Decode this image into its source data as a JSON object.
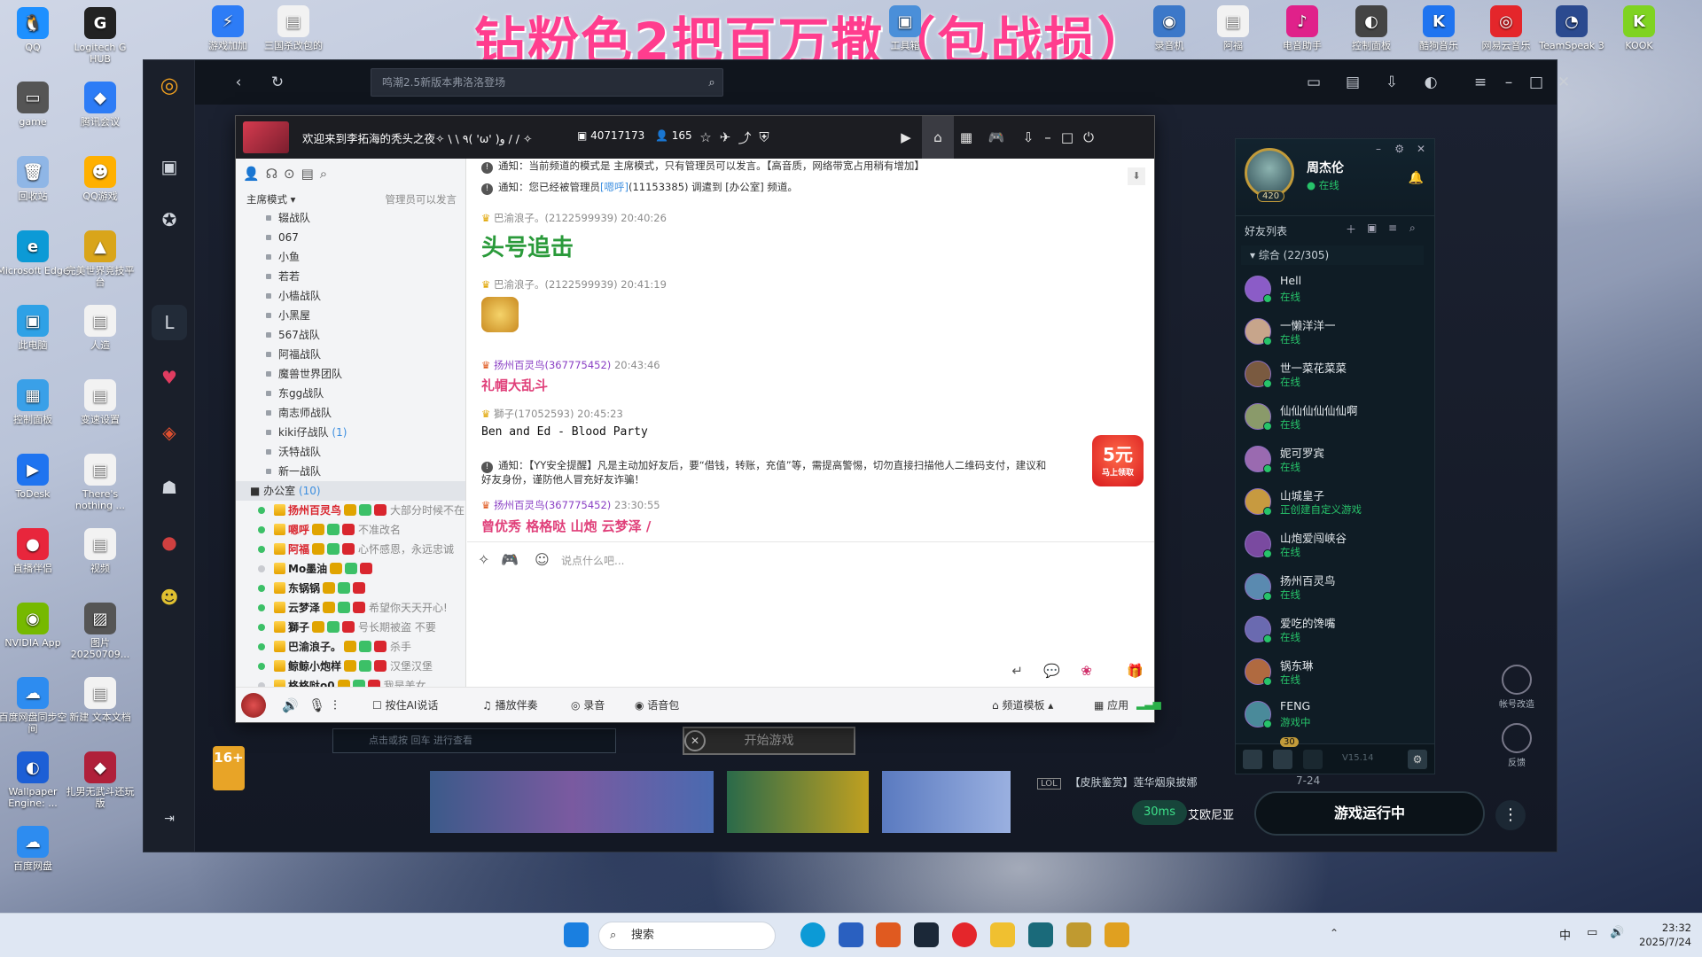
{
  "stream_title": "钻粉色2把百万撒（包战损）",
  "desktop_icons_left": [
    {
      "label": "QQ",
      "color": "#1e90ff",
      "glyph": "🐧"
    },
    {
      "label": "Logitech G HUB",
      "color": "#222222",
      "glyph": "G"
    },
    {
      "label": "game",
      "color": "#555555",
      "glyph": "▭"
    },
    {
      "label": "腾讯会议",
      "color": "#2d7cf6",
      "glyph": "◆"
    },
    {
      "label": "回收站",
      "color": "#8fb6e6",
      "glyph": "🗑"
    },
    {
      "label": "QQ游戏",
      "color": "#ffb000",
      "glyph": "☻"
    },
    {
      "label": "Microsoft Edge",
      "color": "#0c9ad6",
      "glyph": "e"
    },
    {
      "label": "完美世界竞技平台",
      "color": "#d9a51a",
      "glyph": "▲"
    },
    {
      "label": "此电脑",
      "color": "#2ea1e6",
      "glyph": "▣"
    },
    {
      "label": "人造",
      "color": "#f2f2f2",
      "glyph": "▤"
    },
    {
      "label": "控制面板",
      "color": "#3aa0e8",
      "glyph": "▦"
    },
    {
      "label": "变速设置",
      "color": "#f2f2f2",
      "glyph": "▤"
    },
    {
      "label": "ToDesk",
      "color": "#1f74f0",
      "glyph": "▶"
    },
    {
      "label": "There's nothing ...",
      "color": "#f2f2f2",
      "glyph": "▤"
    },
    {
      "label": "直播伴侣",
      "color": "#e8263c",
      "glyph": "●"
    },
    {
      "label": "视频",
      "color": "#f2f2f2",
      "glyph": "▤"
    },
    {
      "label": "NVIDIA App",
      "color": "#76b900",
      "glyph": "◉"
    },
    {
      "label": "图片 20250709...",
      "color": "#555555",
      "glyph": "▨"
    },
    {
      "label": "百度网盘同步空间",
      "color": "#2d8cf0",
      "glyph": "☁"
    },
    {
      "label": "新建 文本文档",
      "color": "#f2f2f2",
      "glyph": "▤"
    },
    {
      "label": "Wallpaper Engine: ...",
      "color": "#1c5fd6",
      "glyph": "◐"
    },
    {
      "label": "扎男无武斗还玩版",
      "color": "#b0203a",
      "glyph": "◆"
    },
    {
      "label": "百度网盘",
      "color": "#2d8cf0",
      "glyph": "☁"
    }
  ],
  "desktop_icons_top": [
    {
      "label": "游戏加加",
      "color": "#2d7cf6",
      "glyph": "⚡"
    },
    {
      "label": "三国杀改包的",
      "color": "#f2f2f2",
      "glyph": "▤"
    },
    {
      "label": "工具箱",
      "color": "#4a8fd9",
      "glyph": "▣"
    },
    {
      "label": "录音机",
      "color": "#3c78c9",
      "glyph": "◉"
    },
    {
      "label": "阿福",
      "color": "#f2f2f2",
      "glyph": "▤"
    },
    {
      "label": "电音助手",
      "color": "#e0218a",
      "glyph": "♪"
    },
    {
      "label": "控制面板",
      "color": "#444444",
      "glyph": "◐"
    },
    {
      "label": "酷狗音乐",
      "color": "#1f74f0",
      "glyph": "K"
    },
    {
      "label": "网易云音乐",
      "color": "#e4262b",
      "glyph": "◎"
    },
    {
      "label": "TeamSpeak 3",
      "color": "#2b4a8f",
      "glyph": "◔"
    },
    {
      "label": "KOOK",
      "color": "#7fd321",
      "glyph": "K"
    }
  ],
  "client": {
    "search_placeholder": "鸣潮2.5新版本弗洛洛登场"
  },
  "yy": {
    "channel_title": "欢迎来到李拓海的秃头之夜✧ \\ \\ ٩( 'ω' )و / / ✧",
    "channel_id": "40717173",
    "online_count": "165",
    "mode": "主席模式",
    "mode_note": "管理员可以发言",
    "subchannels": [
      {
        "name": "辍战队"
      },
      {
        "name": "067"
      },
      {
        "name": "小鱼"
      },
      {
        "name": "若若"
      },
      {
        "name": "小樯战队"
      },
      {
        "name": "小黑屋"
      },
      {
        "name": "567战队"
      },
      {
        "name": "阿福战队"
      },
      {
        "name": "魔兽世界团队"
      },
      {
        "name": "东gg战队"
      },
      {
        "name": "南志师战队"
      },
      {
        "name": "kiki仔战队",
        "count": "(1)"
      },
      {
        "name": "沃特战队"
      },
      {
        "name": "新一战队"
      }
    ],
    "office": {
      "name": "办公室",
      "count": "(10)"
    },
    "members": [
      {
        "nick": "扬州百灵鸟",
        "sig": "大部分时候不在",
        "red": true,
        "online": true
      },
      {
        "nick": "嗯呼",
        "sig": "不准改名",
        "red": true,
        "online": true
      },
      {
        "nick": "阿福",
        "sig": "心怀感恩，永远忠诚",
        "red": true,
        "online": true
      },
      {
        "nick": "Mo墨油",
        "sig": "",
        "red": false,
        "online": false
      },
      {
        "nick": "东锅锅",
        "sig": "",
        "red": false,
        "online": true
      },
      {
        "nick": "云梦泽",
        "sig": "希望你天天开心!",
        "red": false,
        "online": true
      },
      {
        "nick": "獅子",
        "sig": "号长期被盗 不要",
        "red": false,
        "online": true
      },
      {
        "nick": "巴渝浪子。",
        "sig": "杀手",
        "red": false,
        "online": true
      },
      {
        "nick": "鲸鲸小炮样",
        "sig": "汉堡汉堡",
        "red": false,
        "online": true
      },
      {
        "nick": "格格哒o0",
        "sig": "我是美女",
        "red": false,
        "online": false
      }
    ],
    "chat": {
      "notice1": "通知：当前频道的模式是 主席模式，只有管理员可以发言。【高音质，网络带宽占用稍有增加】",
      "notice2_pre": "通知：您已经被管理员",
      "notice2_link": "[嗯呼]",
      "notice2_post": "(11153385) 调遣到 [办公室] 频道。",
      "msg1_meta": "巴渝浪子。(2122599939)  20:40:26",
      "msg1_text": "头号追击",
      "msg2_meta": "巴渝浪子。(2122599939)  20:41:19",
      "msg3_meta_name": "扬州百灵鸟(367775452)",
      "msg3_meta_time": "20:43:46",
      "msg3_text": "礼帽大乱斗",
      "msg4_meta": "獅子(17052593)  20:45:23",
      "msg4_text": "Ben and Ed - Blood Party",
      "notice3_line1": "通知：【YY安全提醒】凡是主动加好友后，要“借钱，转账，充值”等，需提高警惕，切勿直接扫描他人二维码支付，建议和",
      "notice3_line2": "好友身份，谨防他人冒充好友诈骗！",
      "msg5_meta_name": "扬州百灵鸟(367775452)",
      "msg5_meta_time": "23:30:55",
      "msg5_text": "曾优秀 格格哒 山炮 云梦泽 /",
      "redpacket_amount": "5元",
      "redpacket_label": "马上领取"
    },
    "input_placeholder": "说点什么吧...",
    "bottom": {
      "ai_talk": "按住AI说话",
      "accompaniment": "播放伴奏",
      "record": "录音",
      "voice_pack": "语音包",
      "channel_template": "频道模板",
      "apps": "应用"
    }
  },
  "friends": {
    "name": "周杰伦",
    "status": "在线",
    "level": "420",
    "list_title": "好友列表",
    "group": "综合 (22/305)",
    "items": [
      {
        "name": "Hell",
        "status": "在线",
        "color": "#8b5cc7"
      },
      {
        "name": "一懒洋洋一",
        "status": "在线",
        "color": "#c7a58b"
      },
      {
        "name": "世一菜花菜菜",
        "status": "在线",
        "color": "#7a5a40"
      },
      {
        "name": "仙仙仙仙仙仙啊",
        "status": "在线",
        "color": "#8a9a6a"
      },
      {
        "name": "妮可罗宾",
        "status": "在线",
        "color": "#9a6ab0"
      },
      {
        "name": "山城皇子",
        "status": "正创建自定义游戏",
        "color": "#c79a40"
      },
      {
        "name": "山炮爱闯峡谷",
        "status": "在线",
        "color": "#7a4aa0"
      },
      {
        "name": "扬州百灵鸟",
        "status": "在线",
        "color": "#5a8ab0"
      },
      {
        "name": "爱吃的馋嘴",
        "status": "在线",
        "color": "#6a6ab0"
      },
      {
        "name": "锅东琳",
        "status": "在线",
        "color": "#b06a40"
      },
      {
        "name": "FENG",
        "status": "游戏中",
        "color": "#4a8a9a"
      }
    ],
    "version": "V15.14",
    "badge_count": "30"
  },
  "game": {
    "start_game": "开始游戏",
    "running": "游戏运行中",
    "ping": "30ms",
    "server": "艾欧尼亚",
    "news": "【皮肤鉴赏】莲华烟泉披娜",
    "news_date": "7-24",
    "age_rating": "16+",
    "chat_hint": "点击或按 回车 进行查看",
    "side_btn1": "帐号改造",
    "side_btn2": "反馈"
  },
  "taskbar": {
    "search": "搜索",
    "time": "23:32",
    "date": "2025/7/24",
    "ime": "中"
  }
}
